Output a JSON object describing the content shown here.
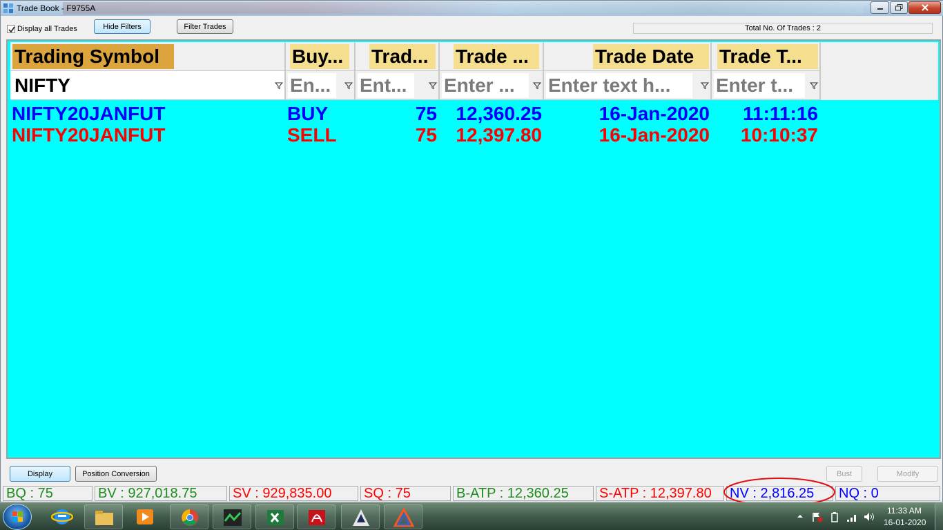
{
  "window": {
    "title": "Trade Book - F9755A",
    "colors": {
      "titlebar": "#b9d1e7",
      "close": "#c7452d"
    }
  },
  "toolbar": {
    "display_all_label": "Display all Trades",
    "display_all_checked": true,
    "hide_filters_label": "Hide Filters",
    "filter_trades_label": "Filter Trades",
    "total_trades_text": "Total No. Of Trades : 2"
  },
  "grid": {
    "background": "#00ffff",
    "columns": [
      {
        "header": "Trading Symbol",
        "filter": "NIFTY"
      },
      {
        "header": "Buy...",
        "filter": "En..."
      },
      {
        "header": "Trad...",
        "filter": "Ent..."
      },
      {
        "header": "Trade ...",
        "filter": "Enter ..."
      },
      {
        "header": "Trade Date",
        "filter": "Enter text h..."
      },
      {
        "header": "Trade T...",
        "filter": "Enter t..."
      }
    ],
    "rows": [
      {
        "side": "buy",
        "symbol": "NIFTY20JANFUT",
        "buy_sell": "BUY",
        "qty": "75",
        "price": "12,360.25",
        "date": "16-Jan-2020",
        "time": "11:11:16",
        "color": "#0000ff"
      },
      {
        "side": "sell",
        "symbol": "NIFTY20JANFUT",
        "buy_sell": "SELL",
        "qty": "75",
        "price": "12,397.80",
        "date": "16-Jan-2020",
        "time": "10:10:37",
        "color": "#ff0000"
      }
    ]
  },
  "actions": {
    "display_label": "Display",
    "position_conversion_label": "Position Conversion",
    "bust_label": "Bust",
    "modify_label": "Modify"
  },
  "summary": {
    "bq": "BQ : 75",
    "bv": "BV : 927,018.75",
    "sv": "SV : 929,835.00",
    "sq": "SQ : 75",
    "batp": "B-ATP : 12,360.25",
    "satp": "S-ATP : 12,397.80",
    "nv": "NV : 2,816.25",
    "nq": "NQ : 0"
  },
  "taskbar": {
    "apps": [
      "internet-explorer",
      "file-explorer",
      "media-player",
      "chrome",
      "trading-app",
      "excel",
      "acrobat",
      "trading-terminal",
      "triangle-app"
    ],
    "time": "11:33 AM",
    "date": "16-01-2020"
  }
}
